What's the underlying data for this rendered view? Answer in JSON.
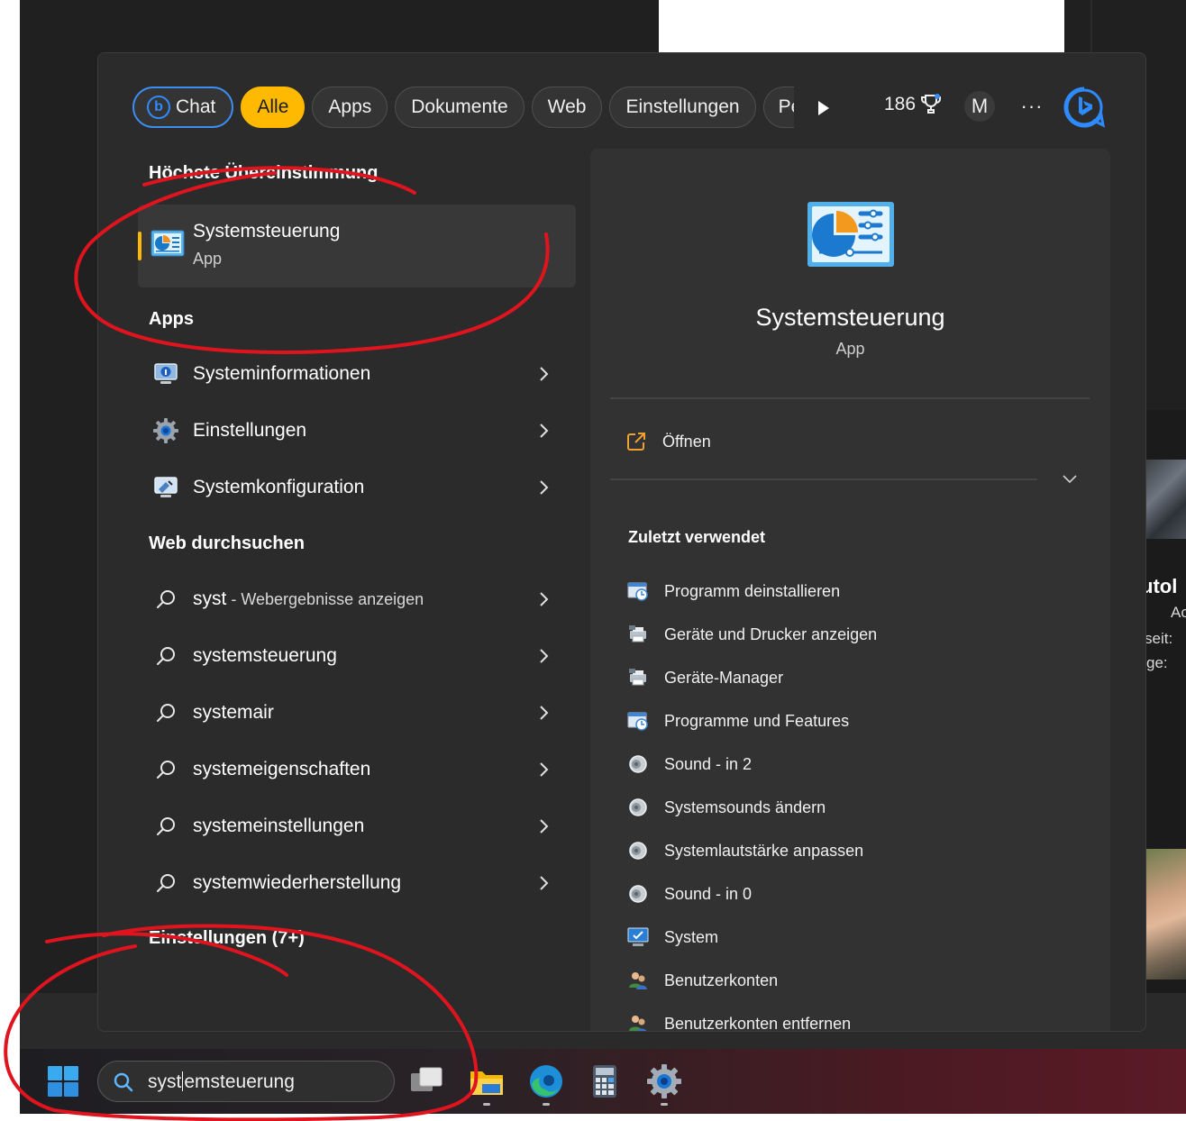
{
  "filters": {
    "chat": "Chat",
    "all": "Alle",
    "apps": "Apps",
    "documents": "Dokumente",
    "web": "Web",
    "settings": "Einstellungen",
    "people_truncated": "Pe"
  },
  "toolbar": {
    "rewards_points": "186",
    "avatar_initial": "M",
    "more": "···"
  },
  "left": {
    "best_match_title": "Höchste Übereinstimmung",
    "best_match": {
      "name": "Systemsteuerung",
      "type": "App"
    },
    "apps_title": "Apps",
    "apps": [
      {
        "label": "Systeminformationen",
        "icon": "system-information-icon"
      },
      {
        "label": "Einstellungen",
        "icon": "settings-gear-icon"
      },
      {
        "label": "Systemkonfiguration",
        "icon": "system-configuration-icon"
      }
    ],
    "web_title": "Web durchsuchen",
    "web_first": {
      "query": "syst",
      "suffix": " - Webergebnisse anzeigen"
    },
    "web": [
      "systemsteuerung",
      "systemair",
      "systemeigenschaften",
      "systemeinstellungen",
      "systemwiederherstellung"
    ],
    "settings_title": "Einstellungen (7+)"
  },
  "preview": {
    "title": "Systemsteuerung",
    "type": "App",
    "open": "Öffnen",
    "recent_title": "Zuletzt verwendet",
    "recent": [
      {
        "label": "Programm deinstallieren",
        "icon": "programs-icon"
      },
      {
        "label": "Geräte und Drucker anzeigen",
        "icon": "devices-printers-icon"
      },
      {
        "label": "Geräte-Manager",
        "icon": "device-manager-icon"
      },
      {
        "label": "Programme und Features",
        "icon": "programs-icon"
      },
      {
        "label": "Sound - in 2",
        "icon": "sound-icon"
      },
      {
        "label": "Systemsounds ändern",
        "icon": "sound-icon"
      },
      {
        "label": "Systemlautstärke anpassen",
        "icon": "sound-icon"
      },
      {
        "label": "Sound - in 0",
        "icon": "sound-icon"
      },
      {
        "label": "System",
        "icon": "system-monitor-icon"
      },
      {
        "label": "Benutzerkonten",
        "icon": "user-accounts-icon"
      },
      {
        "label": "Benutzerkonten entfernen",
        "icon": "user-accounts-icon"
      }
    ]
  },
  "taskbar": {
    "search_before_caret": "syst",
    "search_after_caret": "emsteuerung",
    "apps": [
      "task-view-icon",
      "file-explorer-icon",
      "edge-icon",
      "calculator-icon",
      "settings-gear-icon"
    ]
  },
  "background": {
    "text1": "utol",
    "text2": "Ac",
    "text3": "seit:",
    "text4": "ge:"
  },
  "colors": {
    "accent_yellow": "#ffb900",
    "chat_blue": "#3c8ef3",
    "annotation_red": "#e0141e",
    "flyout_bg": "#2b2b2b",
    "preview_bg": "#323232"
  }
}
